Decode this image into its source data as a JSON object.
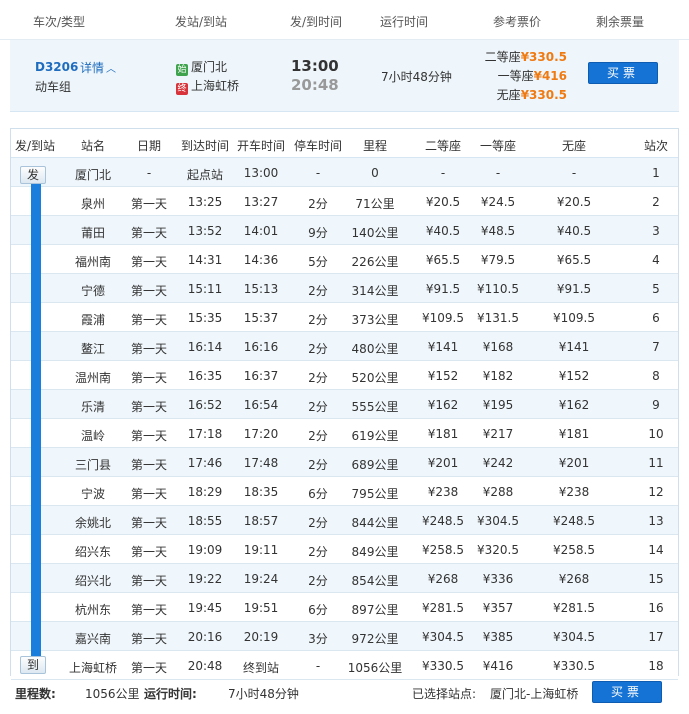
{
  "header": {
    "train_type": "车次/类型",
    "stations": "发站/到站",
    "times": "发/到时间",
    "duration": "运行时间",
    "price": "参考票价",
    "remaining": "剩余票量"
  },
  "train": {
    "number": "D3206",
    "detail": "详情",
    "type": "动车组",
    "from_badge": "始",
    "from": "厦门北",
    "to_badge": "终",
    "to": "上海虹桥",
    "depart": "13:00",
    "arrive": "20:48",
    "duration": "7小时48分钟",
    "prices": [
      {
        "label": "二等座",
        "value": "¥330.5"
      },
      {
        "label": "一等座",
        "value": "¥416"
      },
      {
        "label": "无座",
        "value": "¥330.5"
      }
    ],
    "buy": "买票"
  },
  "table": {
    "columns": [
      "发/到站",
      "站名",
      "日期",
      "到达时间",
      "开车时间",
      "停车时间",
      "里程",
      "二等座",
      "一等座",
      "无座",
      "站次"
    ],
    "start_marker": "发",
    "end_marker": "到",
    "rows": [
      [
        "厦门北",
        "-",
        "起点站",
        "13:00",
        "-",
        "0",
        "-",
        "-",
        "-",
        "1"
      ],
      [
        "泉州",
        "第一天",
        "13:25",
        "13:27",
        "2分",
        "71公里",
        "¥20.5",
        "¥24.5",
        "¥20.5",
        "2"
      ],
      [
        "莆田",
        "第一天",
        "13:52",
        "14:01",
        "9分",
        "140公里",
        "¥40.5",
        "¥48.5",
        "¥40.5",
        "3"
      ],
      [
        "福州南",
        "第一天",
        "14:31",
        "14:36",
        "5分",
        "226公里",
        "¥65.5",
        "¥79.5",
        "¥65.5",
        "4"
      ],
      [
        "宁德",
        "第一天",
        "15:11",
        "15:13",
        "2分",
        "314公里",
        "¥91.5",
        "¥110.5",
        "¥91.5",
        "5"
      ],
      [
        "霞浦",
        "第一天",
        "15:35",
        "15:37",
        "2分",
        "373公里",
        "¥109.5",
        "¥131.5",
        "¥109.5",
        "6"
      ],
      [
        "鳌江",
        "第一天",
        "16:14",
        "16:16",
        "2分",
        "480公里",
        "¥141",
        "¥168",
        "¥141",
        "7"
      ],
      [
        "温州南",
        "第一天",
        "16:35",
        "16:37",
        "2分",
        "520公里",
        "¥152",
        "¥182",
        "¥152",
        "8"
      ],
      [
        "乐清",
        "第一天",
        "16:52",
        "16:54",
        "2分",
        "555公里",
        "¥162",
        "¥195",
        "¥162",
        "9"
      ],
      [
        "温岭",
        "第一天",
        "17:18",
        "17:20",
        "2分",
        "619公里",
        "¥181",
        "¥217",
        "¥181",
        "10"
      ],
      [
        "三门县",
        "第一天",
        "17:46",
        "17:48",
        "2分",
        "689公里",
        "¥201",
        "¥242",
        "¥201",
        "11"
      ],
      [
        "宁波",
        "第一天",
        "18:29",
        "18:35",
        "6分",
        "795公里",
        "¥238",
        "¥288",
        "¥238",
        "12"
      ],
      [
        "余姚北",
        "第一天",
        "18:55",
        "18:57",
        "2分",
        "844公里",
        "¥248.5",
        "¥304.5",
        "¥248.5",
        "13"
      ],
      [
        "绍兴东",
        "第一天",
        "19:09",
        "19:11",
        "2分",
        "849公里",
        "¥258.5",
        "¥320.5",
        "¥258.5",
        "14"
      ],
      [
        "绍兴北",
        "第一天",
        "19:22",
        "19:24",
        "2分",
        "854公里",
        "¥268",
        "¥336",
        "¥268",
        "15"
      ],
      [
        "杭州东",
        "第一天",
        "19:45",
        "19:51",
        "6分",
        "897公里",
        "¥281.5",
        "¥357",
        "¥281.5",
        "16"
      ],
      [
        "嘉兴南",
        "第一天",
        "20:16",
        "20:19",
        "3分",
        "972公里",
        "¥304.5",
        "¥385",
        "¥304.5",
        "17"
      ],
      [
        "上海虹桥",
        "第一天",
        "20:48",
        "终到站",
        "-",
        "1056公里",
        "¥330.5",
        "¥416",
        "¥330.5",
        "18"
      ]
    ]
  },
  "footer": {
    "mileage_label": "里程数:",
    "mileage": "1056公里",
    "runtime_label": "运行时间:",
    "runtime": "7小时48分钟",
    "selected_label": "已选择站点:",
    "selected": "厦门北-上海虹桥",
    "buy": "买票"
  },
  "colors": {
    "accent": "#1673d6",
    "price": "#f07a12",
    "row_alt": "#f0f7fc"
  }
}
